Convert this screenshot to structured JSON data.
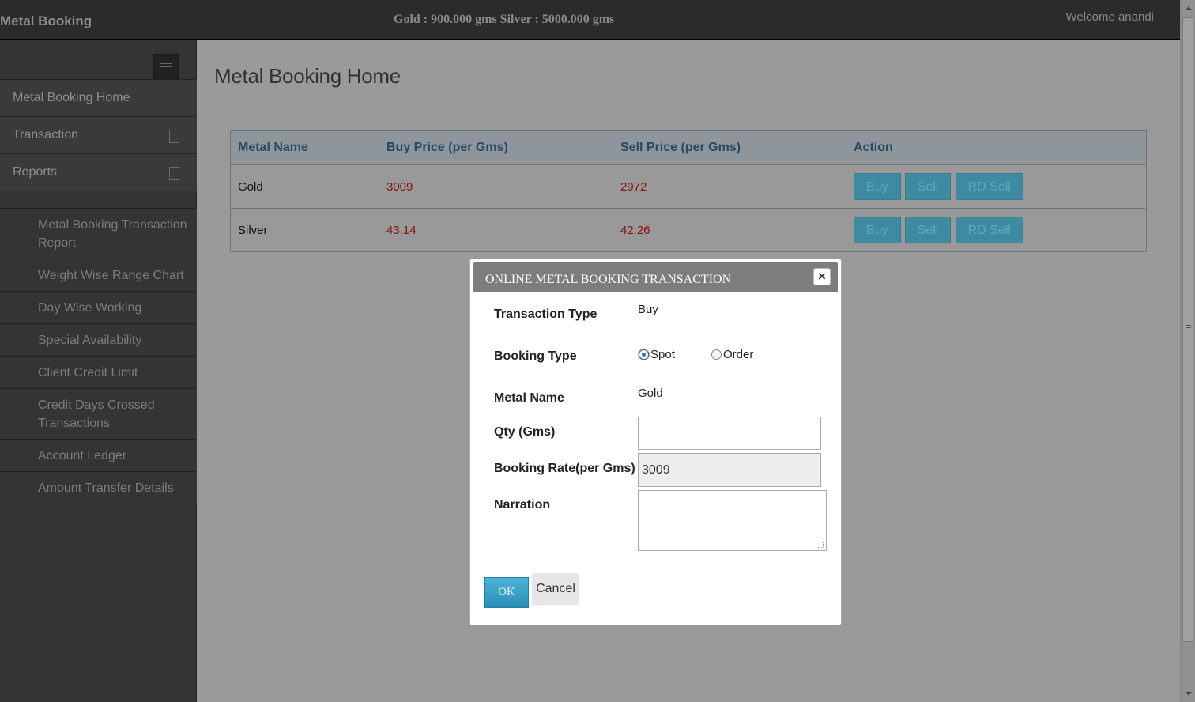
{
  "topbar": {
    "brand": "Metal Booking",
    "stock": "Gold : 900.000 gms Silver : 5000.000 gms",
    "welcome": "Welcome anandi"
  },
  "sidebar": {
    "items": [
      {
        "label": "Metal Booking Home"
      },
      {
        "label": "Transaction"
      },
      {
        "label": "Reports"
      }
    ],
    "reports_submenu": [
      {
        "label": "Metal Booking Transaction Report"
      },
      {
        "label": "Weight Wise Range Chart"
      },
      {
        "label": "Day Wise Working"
      },
      {
        "label": "Special Availability"
      },
      {
        "label": "Client Credit Limit"
      },
      {
        "label": "Credit Days Crossed Transactions"
      },
      {
        "label": "Account Ledger"
      },
      {
        "label": "Amount Transfer Details"
      }
    ]
  },
  "main": {
    "title": "Metal Booking Home",
    "table": {
      "headers": [
        "Metal Name",
        "Buy Price (per Gms)",
        "Sell Price (per Gms)",
        "Action"
      ],
      "rows": [
        {
          "metal": "Gold",
          "buy": "3009",
          "sell": "2972"
        },
        {
          "metal": "Silver",
          "buy": "43.14",
          "sell": "42.26"
        }
      ],
      "actions": {
        "buy": "Buy",
        "sell": "Sell",
        "rd_sell": "RD Sell"
      }
    }
  },
  "modal": {
    "title": "ONLINE METAL BOOKING TRANSACTION",
    "close": "×",
    "transaction_type_label": "Transaction Type",
    "transaction_type_value": "Buy",
    "booking_type_label": "Booking Type",
    "booking_options": {
      "spot": "Spot",
      "order": "Order"
    },
    "booking_selected": "Spot",
    "metal_name_label": "Metal Name",
    "metal_name_value": "Gold",
    "qty_label": "Qty (Gms)",
    "qty_value": "",
    "rate_label": "Booking Rate(per Gms)",
    "rate_value": "3009",
    "narration_label": "Narration",
    "narration_value": "",
    "ok_label": "OK",
    "cancel_label": "Cancel"
  },
  "colors": {
    "topbar": "#2b2b2b",
    "sidebar": "#343434",
    "overlay": "#9a9a9a",
    "action_button": "#3f8aa0",
    "price_text": "#8a1010",
    "ok_button": "#2b8fb5"
  }
}
